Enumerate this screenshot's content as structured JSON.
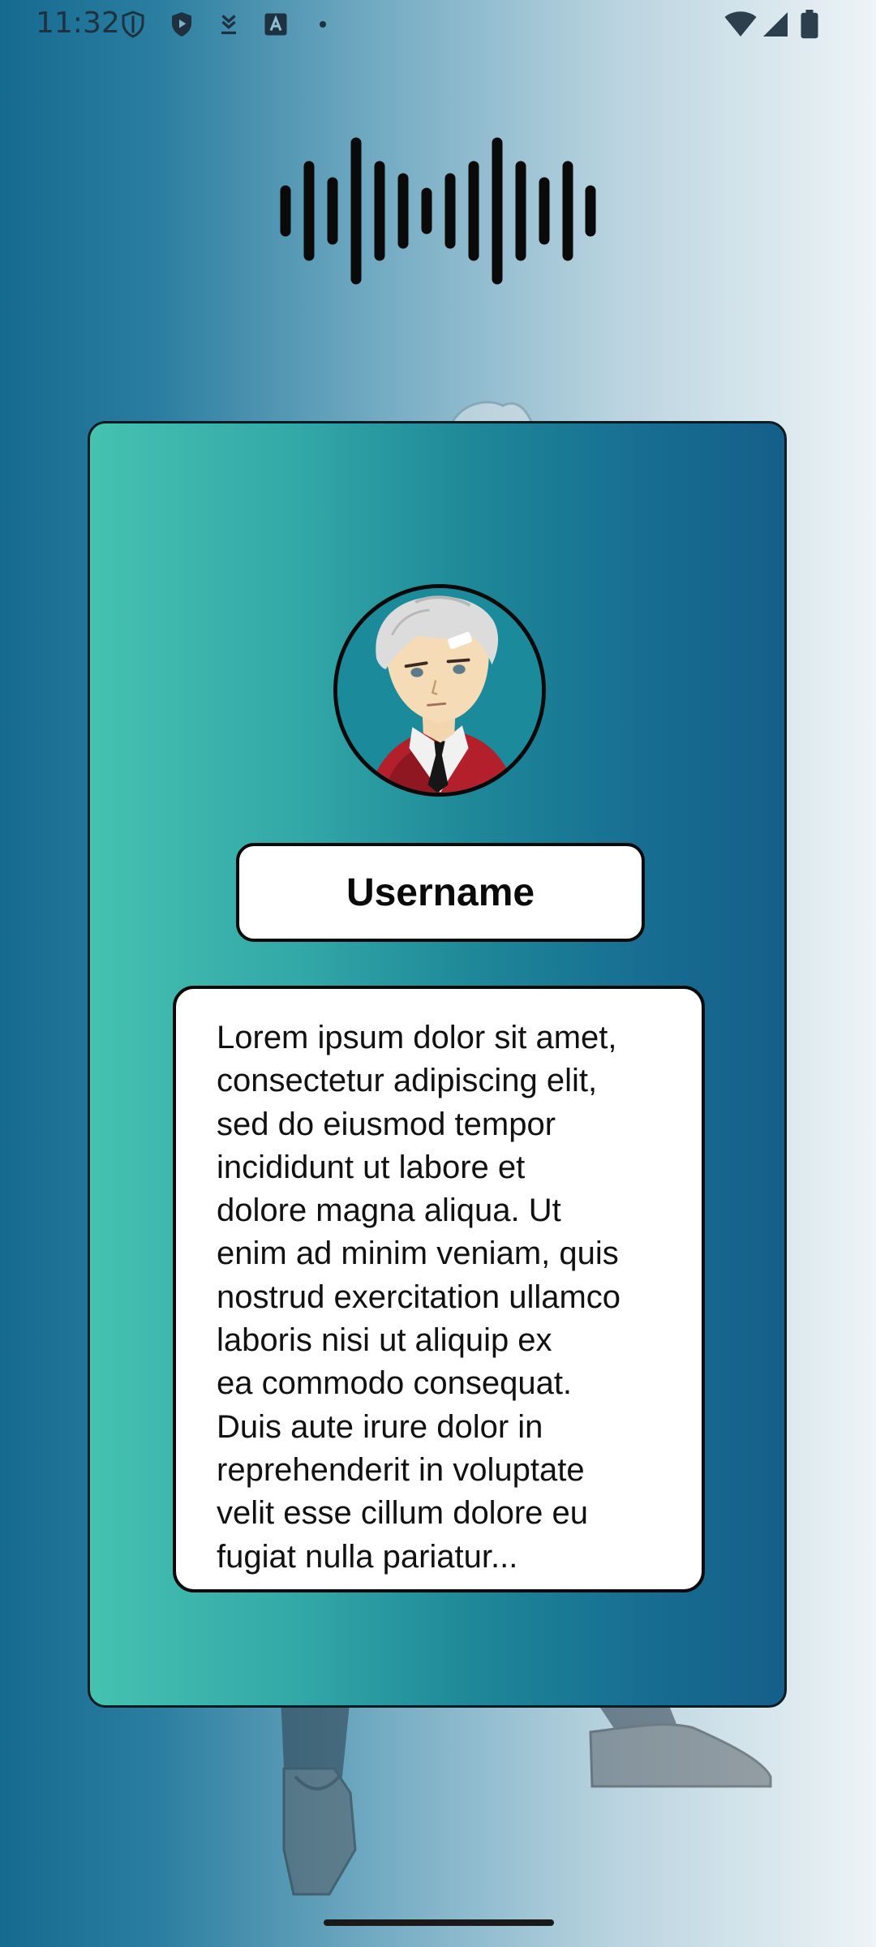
{
  "status_bar": {
    "time": "11:32",
    "left_icons": [
      "shield-outline-icon",
      "shield-play-icon",
      "download-icon",
      "font-a-icon",
      "dot-icon"
    ],
    "right_icons": [
      "wifi-icon",
      "signal-icon",
      "battery-icon"
    ]
  },
  "header": {
    "icon": "voice-wave-icon"
  },
  "profile": {
    "username": "Username",
    "bio": "Lorem ipsum dolor sit amet,\nconsectetur adipiscing elit,\nsed do eiusmod tempor\nincididunt ut labore et\ndolore magna aliqua. Ut\nenim ad minim veniam, quis\nnostrud exercitation ullamco\nlaboris nisi ut aliquip ex\nea commodo consequat.\nDuis aute irure dolor in\nreprehenderit in voluptate\nvelit esse cillum dolore eu\nfugiat nulla pariatur..."
  },
  "colors": {
    "card_gradient_start": "#45c2b0",
    "card_gradient_end": "#155f8a",
    "background_left": "#156a90",
    "background_right": "#eef4f7",
    "outline": "#0a0a0a"
  }
}
